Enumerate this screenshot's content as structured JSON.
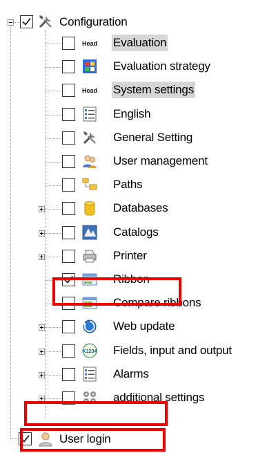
{
  "tree": {
    "root": {
      "label": "Configuration",
      "checked": true,
      "icon": "tools-icon"
    },
    "items": [
      {
        "label": "Evaluation",
        "icon": "head-icon",
        "checked": false,
        "selected": true,
        "expandable": false
      },
      {
        "label": "Evaluation strategy",
        "icon": "strategy-icon",
        "checked": false,
        "selected": false,
        "expandable": false
      },
      {
        "label": "System settings",
        "icon": "head-icon",
        "checked": false,
        "selected": true,
        "expandable": false
      },
      {
        "label": "English",
        "icon": "list-icon",
        "checked": false,
        "selected": false,
        "expandable": false
      },
      {
        "label": "General Setting",
        "icon": "tools-icon",
        "checked": false,
        "selected": false,
        "expandable": false
      },
      {
        "label": "User management",
        "icon": "users-icon",
        "checked": false,
        "selected": false,
        "expandable": false
      },
      {
        "label": "Paths",
        "icon": "paths-icon",
        "checked": false,
        "selected": false,
        "expandable": false
      },
      {
        "label": "Databases",
        "icon": "database-icon",
        "checked": false,
        "selected": false,
        "expandable": true
      },
      {
        "label": "Catalogs",
        "icon": "catalog-icon",
        "checked": false,
        "selected": false,
        "expandable": true
      },
      {
        "label": "Printer",
        "icon": "printer-icon",
        "checked": false,
        "selected": false,
        "expandable": true
      },
      {
        "label": "Ribbon",
        "icon": "ribbon-icon",
        "checked": true,
        "selected": false,
        "expandable": false
      },
      {
        "label": "Compare ribbons",
        "icon": "ribbon-icon",
        "checked": false,
        "selected": false,
        "expandable": false
      },
      {
        "label": "Web update",
        "icon": "web-update-icon",
        "checked": false,
        "selected": false,
        "expandable": true
      },
      {
        "label": "Fields, input and output",
        "icon": "fields-icon",
        "checked": false,
        "selected": false,
        "expandable": true
      },
      {
        "label": "Alarms",
        "icon": "list-icon",
        "checked": false,
        "selected": false,
        "expandable": true
      },
      {
        "label": "additional settings",
        "icon": "settings-icon",
        "checked": false,
        "selected": false,
        "expandable": true
      }
    ],
    "last": {
      "label": "User login",
      "checked": true,
      "icon": "user-icon"
    }
  },
  "icons": {
    "head_text": "Head",
    "fields_text": "K1234"
  },
  "colors": {
    "highlight": "#ee0000",
    "selection": "#d6d6d6"
  }
}
